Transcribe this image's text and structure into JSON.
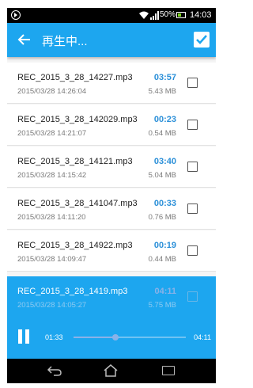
{
  "status_bar": {
    "battery_percent": "50%",
    "battery_level": 0.5,
    "time": "14:03"
  },
  "app_bar": {
    "title": "再生中..."
  },
  "recordings": [
    {
      "file_name": "REC_2015_3_28_14227.mp3",
      "date": "2015/03/28 14:26:04",
      "duration": "03:57",
      "size": "5.43 MB"
    },
    {
      "file_name": "REC_2015_3_28_142029.mp3",
      "date": "2015/03/28 14:21:07",
      "duration": "00:23",
      "size": "0.54 MB"
    },
    {
      "file_name": "REC_2015_3_28_14121.mp3",
      "date": "2015/03/28 14:15:42",
      "duration": "03:40",
      "size": "5.04 MB"
    },
    {
      "file_name": "REC_2015_3_28_141047.mp3",
      "date": "2015/03/28 14:11:20",
      "duration": "00:33",
      "size": "0.76 MB"
    },
    {
      "file_name": "REC_2015_3_28_14922.mp3",
      "date": "2015/03/28 14:09:47",
      "duration": "00:19",
      "size": "0.44 MB"
    }
  ],
  "now_playing": {
    "file_name": "REC_2015_3_28_1419.mp3",
    "date": "2015/03/28 14:05:27",
    "duration": "04:11",
    "size": "5.75 MB",
    "current_time": "01:33",
    "total_time": "04:11",
    "progress": 0.37
  },
  "colors": {
    "accent": "#1da6ef",
    "duration_text": "#2a8fd8",
    "status_bar": "#000000"
  }
}
